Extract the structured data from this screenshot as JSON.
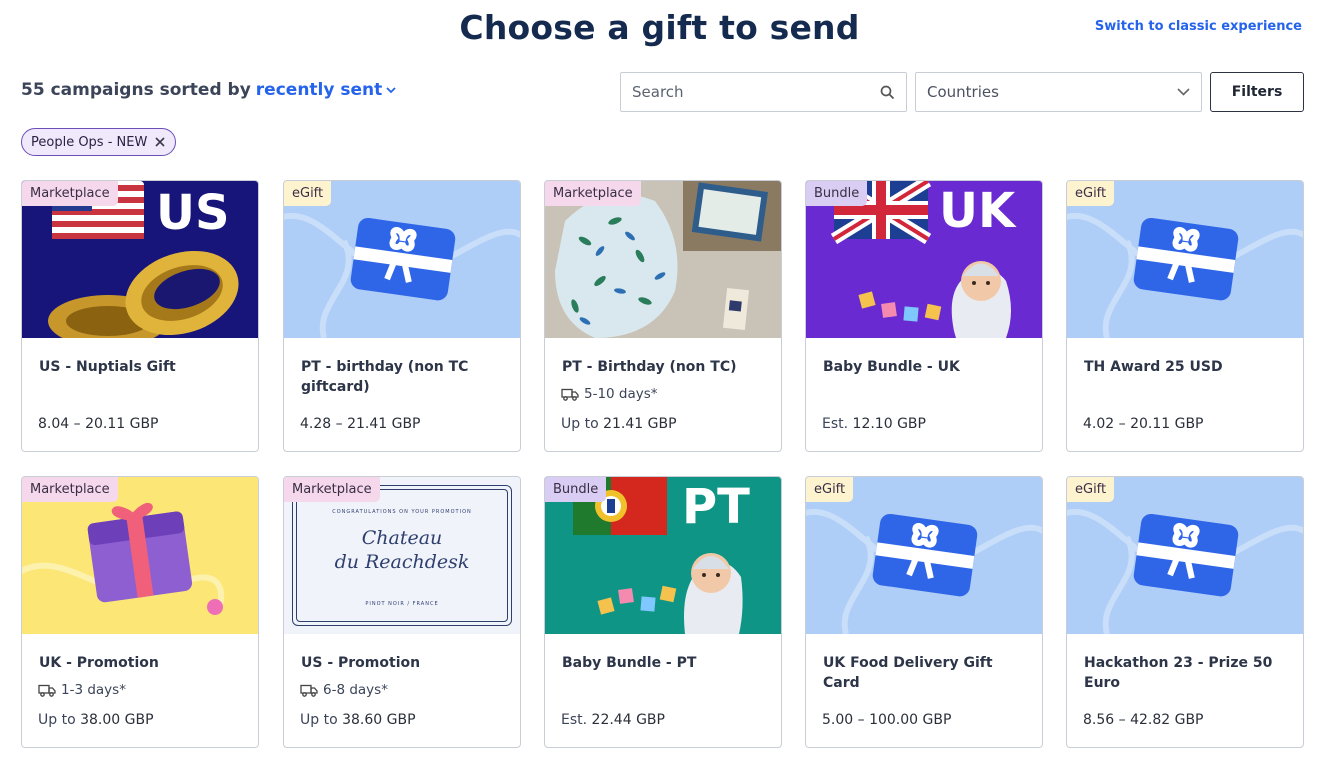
{
  "header": {
    "title": "Choose a gift to send",
    "switch_link": "Switch to classic experience"
  },
  "sort": {
    "count_text": "55 campaigns sorted by",
    "sort_key": "recently sent"
  },
  "search": {
    "placeholder": "Search",
    "value": ""
  },
  "countries": {
    "label": "Countries"
  },
  "filters_label": "Filters",
  "active_filter_chip": "People Ops - NEW",
  "colors": {
    "brand_blue": "#2563eb",
    "title_navy": "#152a4f",
    "marketplace_tag": "#f5d8ec",
    "egift_tag": "#fdf3cf",
    "bundle_tag": "#d9cdf3",
    "egift_bg": "#aecdf7",
    "egift_icon": "#2f66e8"
  },
  "cards": [
    {
      "tag": "Marketplace",
      "image": "us-flag-rings",
      "image_text": "US",
      "name": "US - Nuptials Gift",
      "delivery": "",
      "price_prefix": "",
      "price": "8.04 – 20.11 GBP"
    },
    {
      "tag": "eGift",
      "image": "egift-gift-card-icon",
      "image_text": "",
      "name": "PT - birthday (non TC giftcard)",
      "delivery": "",
      "price_prefix": "",
      "price": "4.28 – 21.41 GBP"
    },
    {
      "tag": "Marketplace",
      "image": "floral-notebook-box",
      "image_text": "",
      "name": "PT - Birthday (non TC)",
      "delivery": "5-10 days*",
      "price_prefix": "Up to",
      "price": "21.41 GBP"
    },
    {
      "tag": "Bundle",
      "image": "uk-flag-baby",
      "image_text": "UK",
      "name": "Baby Bundle - UK",
      "delivery": "",
      "price_prefix": "Est.",
      "price": "12.10 GBP"
    },
    {
      "tag": "eGift",
      "image": "egift-gift-card-icon",
      "image_text": "",
      "name": "TH Award 25 USD",
      "delivery": "",
      "price_prefix": "",
      "price": "4.02 – 20.11 GBP"
    },
    {
      "tag": "Marketplace",
      "image": "purple-gift-box",
      "image_text": "",
      "name": "UK - Promotion",
      "delivery": "1-3 days*",
      "price_prefix": "Up to",
      "price": "38.00 GBP"
    },
    {
      "tag": "Marketplace",
      "image": "wine-label",
      "image_text": "",
      "label_top": "CONGRATULATIONS ON YOUR PROMOTION",
      "label_line1": "Chateau",
      "label_line2": "du Reachdesk",
      "label_bottom": "PINOT NOIR / FRANCE",
      "name": "US - Promotion",
      "delivery": "6-8 days*",
      "price_prefix": "Up to",
      "price": "38.60 GBP"
    },
    {
      "tag": "Bundle",
      "image": "pt-flag-baby",
      "image_text": "PT",
      "name": "Baby Bundle - PT",
      "delivery": "",
      "price_prefix": "Est.",
      "price": "22.44 GBP"
    },
    {
      "tag": "eGift",
      "image": "egift-gift-card-icon",
      "image_text": "",
      "name": "UK Food Delivery Gift Card",
      "delivery": "",
      "price_prefix": "",
      "price": "5.00 – 100.00 GBP"
    },
    {
      "tag": "eGift",
      "image": "egift-gift-card-icon",
      "image_text": "",
      "name": "Hackathon 23 - Prize 50 Euro",
      "delivery": "",
      "price_prefix": "",
      "price": "8.56 – 42.82 GBP"
    }
  ]
}
